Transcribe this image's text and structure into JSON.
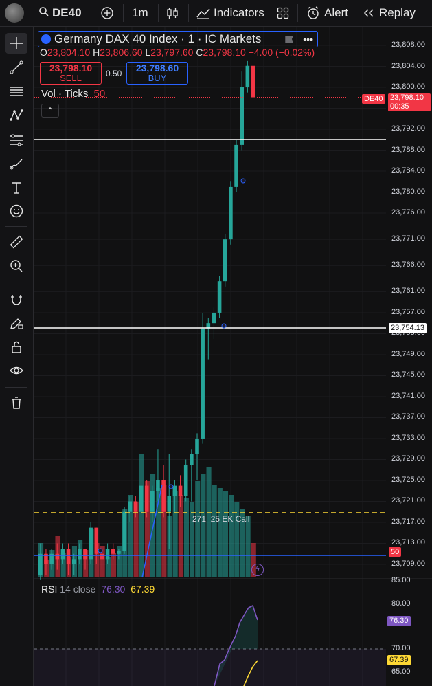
{
  "topbar": {
    "symbol": "DE40",
    "interval": "1m",
    "indicators_label": "Indicators",
    "alert_label": "Alert",
    "replay_label": "Replay"
  },
  "legend": {
    "title": "Germany DAX 40 Index · 1 · IC Markets",
    "o_label": "O",
    "o_value": "23,804.10",
    "h_label": "H",
    "h_value": "23,806.60",
    "l_label": "L",
    "l_value": "23,797.60",
    "c_label": "C",
    "c_value": "23,798.10",
    "change": "−4.00 (−0.02%)",
    "sell_price": "23,798.10",
    "sell_label": "SELL",
    "spread": "0.50",
    "buy_price": "23,798.60",
    "buy_label": "BUY",
    "vol_label": "Vol · Ticks",
    "vol_value": "50",
    "annotation": "271  25 EK Call"
  },
  "rsi": {
    "label": "RSI",
    "params": "14 close",
    "value": "76.30",
    "ma_value": "67.39"
  },
  "price_axis": {
    "ticks": [
      "23,808.00",
      "23,804.00",
      "23,800.00",
      "23,796.00",
      "23,792.00",
      "23,788.00",
      "23,784.00",
      "23,780.00",
      "23,776.00",
      "23,771.00",
      "23,766.00",
      "23,761.00",
      "23,757.00",
      "23,753.00",
      "23,749.00",
      "23,745.00",
      "23,741.00",
      "23,737.00",
      "23,733.00",
      "23,729.00",
      "23,725.00",
      "23,721.00",
      "23,717.00",
      "23,713.00",
      "23,709.00"
    ],
    "current_tag_symbol": "DE40",
    "current_tag_price": "23,798.10",
    "current_tag_time": "00:35",
    "hline_tag": "23,754.13",
    "vol_tag": "50"
  },
  "rsi_axis": {
    "ticks": [
      "85.00",
      "80.00",
      "70.00",
      "65.00"
    ],
    "value_tag": "76.30",
    "ma_tag": "67.39"
  },
  "colors": {
    "up": "#26a69a",
    "down": "#f23645",
    "background": "#111112",
    "accent": "#2962ff",
    "rsi_line": "#7e57c2",
    "rsi_ma": "#fdd835"
  },
  "chart_data": {
    "type": "candlestick",
    "interval": "1m",
    "last_close": 23798.1,
    "horizontal_lines": [
      23789.5,
      23754.13
    ],
    "dashed_line": 23719,
    "candles": [
      {
        "o": 23707,
        "c": 23711,
        "h": 23713,
        "l": 23706
      },
      {
        "o": 23711,
        "c": 23709,
        "h": 23712,
        "l": 23707
      },
      {
        "o": 23709,
        "c": 23711,
        "h": 23712,
        "l": 23708
      },
      {
        "o": 23711,
        "c": 23710,
        "h": 23713,
        "l": 23708
      },
      {
        "o": 23710,
        "c": 23712,
        "h": 23713,
        "l": 23709
      },
      {
        "o": 23712,
        "c": 23709,
        "h": 23713,
        "l": 23707
      },
      {
        "o": 23709,
        "c": 23710,
        "h": 23711,
        "l": 23707
      },
      {
        "o": 23710,
        "c": 23712,
        "h": 23713,
        "l": 23709
      },
      {
        "o": 23712,
        "c": 23710,
        "h": 23712,
        "l": 23708
      },
      {
        "o": 23710,
        "c": 23716,
        "h": 23717,
        "l": 23709
      },
      {
        "o": 23716,
        "c": 23711,
        "h": 23716,
        "l": 23709
      },
      {
        "o": 23711,
        "c": 23710,
        "h": 23712,
        "l": 23708
      },
      {
        "o": 23710,
        "c": 23712,
        "h": 23713,
        "l": 23709
      },
      {
        "o": 23712,
        "c": 23711,
        "h": 23713,
        "l": 23710
      },
      {
        "o": 23711,
        "c": 23711.5,
        "h": 23712,
        "l": 23710
      },
      {
        "o": 23711.5,
        "c": 23719,
        "h": 23720,
        "l": 23711
      },
      {
        "o": 23719,
        "c": 23721,
        "h": 23722,
        "l": 23717
      },
      {
        "o": 23721,
        "c": 23719,
        "h": 23722,
        "l": 23718
      },
      {
        "o": 23719,
        "c": 23724,
        "h": 23733,
        "l": 23712
      },
      {
        "o": 23724,
        "c": 23719,
        "h": 23725,
        "l": 23718
      },
      {
        "o": 23719,
        "c": 23723,
        "h": 23724,
        "l": 23717
      },
      {
        "o": 23723,
        "c": 23725,
        "h": 23731,
        "l": 23721
      },
      {
        "o": 23725,
        "c": 23719,
        "h": 23728,
        "l": 23718
      },
      {
        "o": 23719,
        "c": 23722,
        "h": 23730,
        "l": 23712
      },
      {
        "o": 23722,
        "c": 23724,
        "h": 23725,
        "l": 23719
      },
      {
        "o": 23724,
        "c": 23722,
        "h": 23726,
        "l": 23720
      },
      {
        "o": 23722,
        "c": 23728,
        "h": 23729,
        "l": 23721
      },
      {
        "o": 23728,
        "c": 23730,
        "h": 23731,
        "l": 23721
      },
      {
        "o": 23730,
        "c": 23733,
        "h": 23734,
        "l": 23725
      },
      {
        "o": 23733,
        "c": 23754,
        "h": 23757,
        "l": 23732
      },
      {
        "o": 23754,
        "c": 23755,
        "h": 23756,
        "l": 23748
      },
      {
        "o": 23755,
        "c": 23757,
        "h": 23758,
        "l": 23752
      },
      {
        "o": 23757,
        "c": 23763,
        "h": 23764,
        "l": 23756
      },
      {
        "o": 23763,
        "c": 23771,
        "h": 23772,
        "l": 23762
      },
      {
        "o": 23771,
        "c": 23781,
        "h": 23782,
        "l": 23770
      },
      {
        "o": 23781,
        "c": 23789,
        "h": 23790,
        "l": 23780
      },
      {
        "o": 23789,
        "c": 23800,
        "h": 23803,
        "l": 23788
      },
      {
        "o": 23800,
        "c": 23804.1,
        "h": 23805,
        "l": 23799
      },
      {
        "o": 23804.1,
        "c": 23798.1,
        "h": 23806.6,
        "l": 23797.6
      }
    ],
    "volume": [
      10,
      5,
      8,
      12,
      7,
      6,
      9,
      11,
      8,
      14,
      10,
      9,
      6,
      7,
      9,
      20,
      24,
      22,
      36,
      28,
      30,
      26,
      27,
      18,
      25,
      24,
      23,
      22,
      28,
      30,
      32,
      27,
      26,
      25,
      24,
      22,
      20,
      18,
      10
    ]
  }
}
